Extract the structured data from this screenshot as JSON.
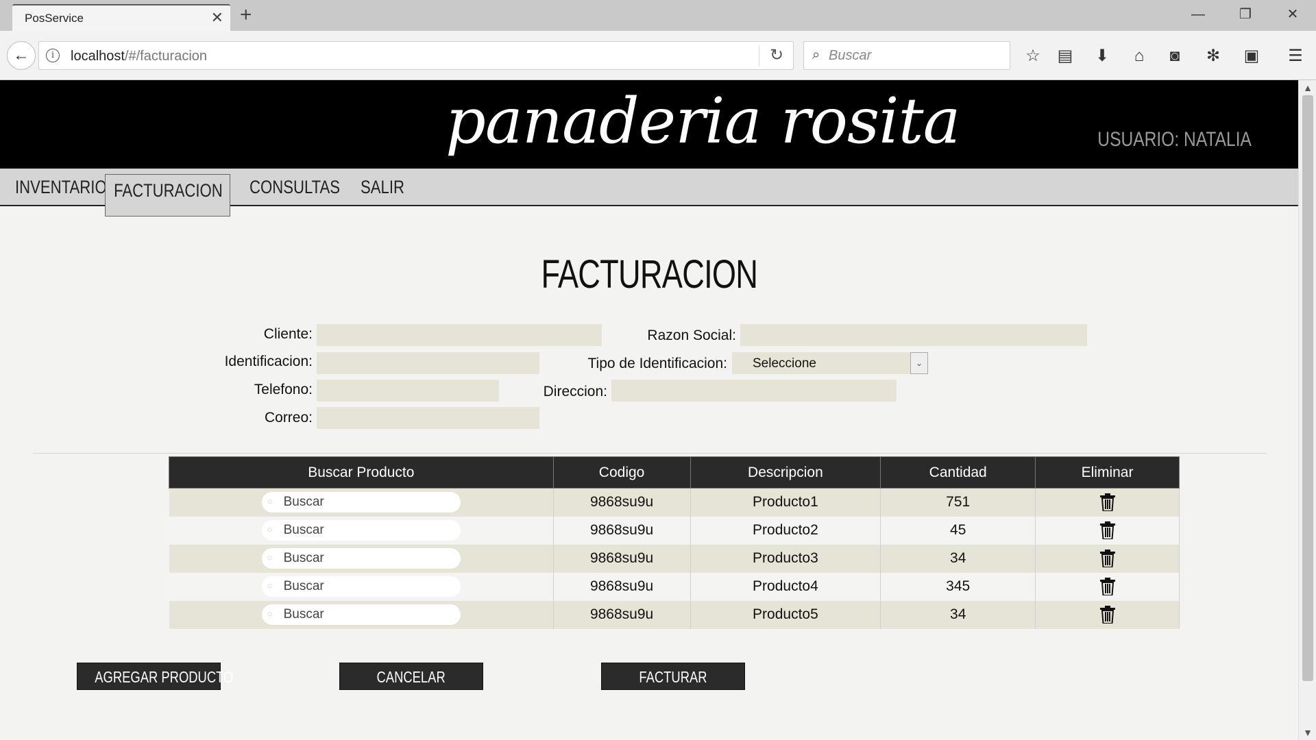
{
  "browser": {
    "tab_title": "PosService",
    "url_host": "localhost",
    "url_path": "/#/facturacion",
    "search_placeholder": "Buscar"
  },
  "header": {
    "logo": "panaderia rosita",
    "user": "USUARIO: NATALIA"
  },
  "menu": {
    "items": [
      {
        "label": "INVENTARIO"
      },
      {
        "label": "FACTURACION"
      },
      {
        "label": "CONSULTAS"
      },
      {
        "label": "SALIR"
      }
    ],
    "active": "FACTURACION"
  },
  "form": {
    "title": "FACTURACION",
    "cliente_label": "Cliente:",
    "razon_social_label": "Razon Social:",
    "identificacion_label": "Identificacion:",
    "tipo_identificacion_label": "Tipo de Identificacion:",
    "tipo_identificacion_value": "Seleccione",
    "telefono_label": "Telefono:",
    "direccion_label": "Direccion:",
    "correo_label": "Correo:"
  },
  "table": {
    "headers": [
      "Buscar Producto",
      "Codigo",
      "Descripcion",
      "Cantidad",
      "Eliminar"
    ],
    "search_placeholder": "Buscar",
    "rows": [
      {
        "codigo": "9868su9u",
        "descripcion": "Producto1",
        "cantidad": "751"
      },
      {
        "codigo": "9868su9u",
        "descripcion": "Producto2",
        "cantidad": "45"
      },
      {
        "codigo": "9868su9u",
        "descripcion": "Producto3",
        "cantidad": "34"
      },
      {
        "codigo": "9868su9u",
        "descripcion": "Producto4",
        "cantidad": "345"
      },
      {
        "codigo": "9868su9u",
        "descripcion": "Producto5",
        "cantidad": "34"
      }
    ]
  },
  "buttons": {
    "agregar": "AGREGAR PRODUCTO",
    "cancelar": "CANCELAR",
    "facturar": "FACTURAR"
  },
  "colors": {
    "header_bg": "#000000",
    "input_bg": "#e6e4d6",
    "table_header_bg": "#2a2a2a",
    "button_bg": "#2b2b2b"
  }
}
